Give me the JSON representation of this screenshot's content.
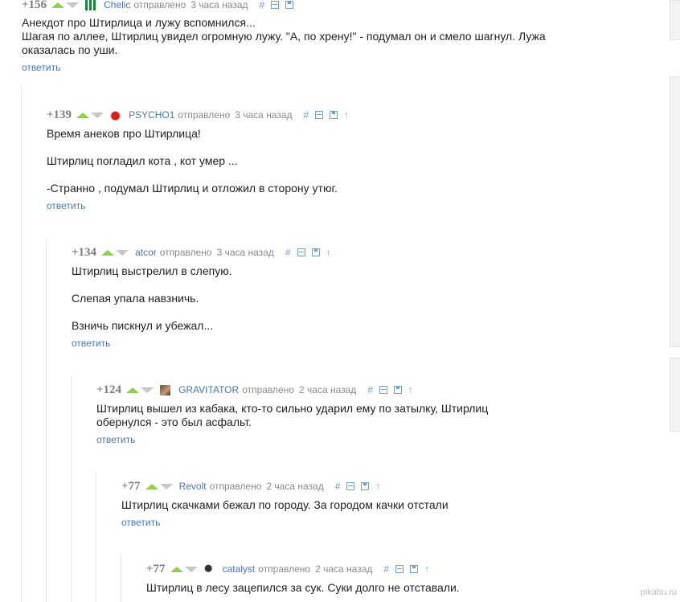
{
  "sent_label": "отправлено",
  "reply_label": "ответить",
  "watermark": "pikabu.ru",
  "colors": {
    "link": "#4a77b4",
    "vote_up": "#8fd14f",
    "vote_down": "#c6c6c6",
    "icon": "#6f9fd0"
  },
  "comments": [
    {
      "rating": "+156",
      "user": "Chelic",
      "time": "3 часа назад",
      "avatar_icon": "avatar-green-icon",
      "lines": [
        "Анекдот про Штирлица и лужу вспомнился...",
        "Шагая по аллее, Штирлиц увидел огромную лужу. \"А, по хрену!\" - подумал он и смело шагнул. Лужа оказалась по уши."
      ]
    },
    {
      "rating": "+139",
      "user": "PSYCHO1",
      "time": "3 часа назад",
      "avatar_icon": "avatar-red-icon",
      "lines": [
        "Время анеков про Штирлица!",
        "Штирлиц погладил кота , кот умер ...",
        "-Странно , подумал Штирлиц и отложил в сторону утюг."
      ]
    },
    {
      "rating": "+134",
      "user": "atcor",
      "time": "3 часа назад",
      "avatar_icon": "",
      "lines": [
        "Штирлиц выстрелил в слепую.",
        "Слепая упала навзничь.",
        "Взничь пискнул и убежал..."
      ]
    },
    {
      "rating": "+124",
      "user": "GRAVITATOR",
      "time": "2 часа назад",
      "avatar_icon": "avatar-photo-icon",
      "lines": [
        "Штирлиц вышел из кабака, кто-то сильно ударил ему по затылку, Штирлиц обернулся - это был асфальт."
      ]
    },
    {
      "rating": "+77",
      "user": "Revolt",
      "time": "2 часа назад",
      "avatar_icon": "",
      "lines": [
        "Штирлиц скачками бежал по городу. За городом качки отстали"
      ]
    },
    {
      "rating": "+77",
      "user": "catalyst",
      "time": "2 часа назад",
      "avatar_icon": "avatar-horse-icon",
      "lines": [
        "Штирлиц в лесу зацепился за сук. Суки долго не отставали."
      ]
    }
  ]
}
